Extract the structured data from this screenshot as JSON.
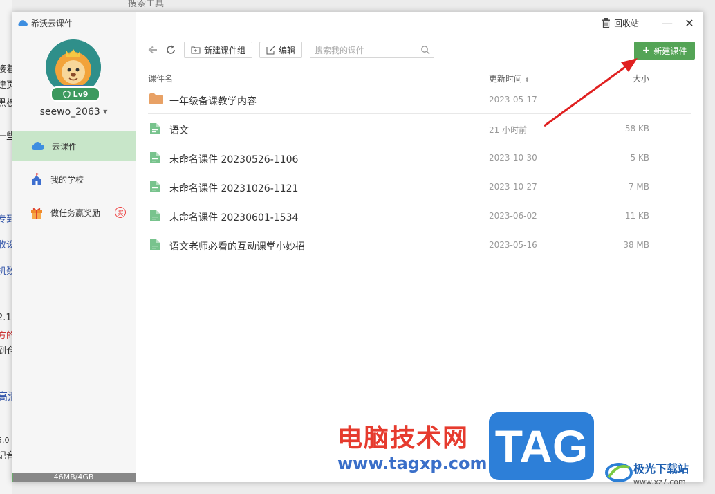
{
  "background": {
    "top_hint": "搜索工具",
    "left_fragments": [
      "接着",
      "建页",
      "黑板",
      "一些",
      "专到",
      "收设",
      "机数",
      "2.1.",
      "方的",
      "到仓",
      "高清",
      "5.0",
      "记音"
    ]
  },
  "app": {
    "title": "希沃云课件",
    "user": {
      "name": "seewo_2063",
      "level": "Lv9"
    },
    "storage": {
      "label": "46MB/4GB",
      "fraction": 0.0112
    }
  },
  "sidebar": {
    "items": [
      {
        "label": "云课件",
        "icon": "cloud-icon"
      },
      {
        "label": "我的学校",
        "icon": "school-icon"
      },
      {
        "label": "做任务赢奖励",
        "icon": "gift-icon",
        "badge": "奖"
      }
    ]
  },
  "topbar": {
    "recycle_label": "回收站",
    "minimize": "—",
    "close": "✕"
  },
  "toolbar": {
    "new_group_label": "新建课件组",
    "edit_label": "编辑",
    "search_placeholder": "搜索我的课件",
    "new_courseware_label": "新建课件"
  },
  "table": {
    "columns": {
      "name": "课件名",
      "updated": "更新时间",
      "size": "大小"
    },
    "rows": [
      {
        "type": "folder",
        "name": "一年级备课教学内容",
        "updated": "2023-05-17",
        "size": ""
      },
      {
        "type": "file",
        "name": "语文",
        "updated": "21 小时前",
        "size": "58 KB"
      },
      {
        "type": "file",
        "name": "未命名课件 20230526-1106",
        "updated": "2023-10-30",
        "size": "5 KB"
      },
      {
        "type": "file",
        "name": "未命名课件 20231026-1121",
        "updated": "2023-10-27",
        "size": "7 MB"
      },
      {
        "type": "file",
        "name": "未命名课件 20230601-1534",
        "updated": "2023-06-02",
        "size": "11 KB"
      },
      {
        "type": "file",
        "name": "语文老师必看的互动课堂小妙招",
        "updated": "2023-05-16",
        "size": "38 MB"
      }
    ]
  },
  "watermark": {
    "cn": "电脑技术网",
    "url": "www.tagxp.com",
    "tag": "TAG",
    "site_cn": "极光下载站",
    "site_url": "www.xz7.com"
  },
  "colors": {
    "accent": "#54a456",
    "active_nav": "#c8e6c9",
    "arrow": "#e02020"
  }
}
